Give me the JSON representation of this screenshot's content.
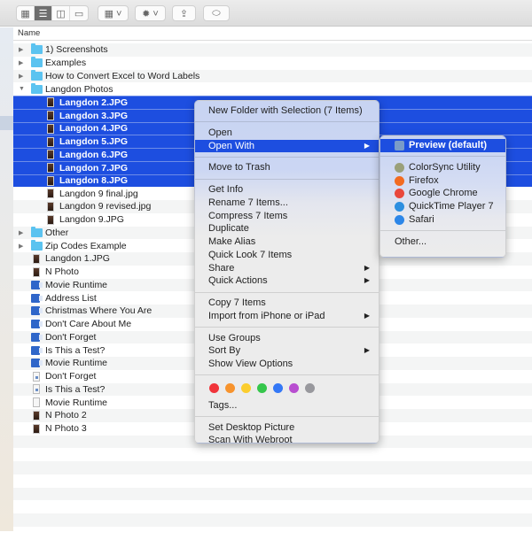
{
  "toolbar": {
    "view_buttons": [
      "icon-view",
      "list-view",
      "column-view",
      "gallery-view"
    ],
    "active_view": "list-view",
    "group_button": "group-icon",
    "action_button": "gear-icon",
    "share_button": "share-icon",
    "tag_button": "tag-icon"
  },
  "header": {
    "name_column": "Name"
  },
  "files": [
    {
      "name": "1) Screenshots",
      "type": "folder",
      "level": 0,
      "disclosure": "collapsed"
    },
    {
      "name": "Examples",
      "type": "folder",
      "level": 0,
      "disclosure": "collapsed"
    },
    {
      "name": "How to Convert Excel to Word Labels",
      "type": "folder",
      "level": 0,
      "disclosure": "collapsed"
    },
    {
      "name": "Langdon Photos",
      "type": "folder",
      "level": 0,
      "disclosure": "expanded"
    },
    {
      "name": "Langdon 2.JPG",
      "type": "image",
      "level": 1,
      "selected": true
    },
    {
      "name": "Langdon 3.JPG",
      "type": "image",
      "level": 1,
      "selected": true
    },
    {
      "name": "Langdon 4.JPG",
      "type": "image",
      "level": 1,
      "selected": true
    },
    {
      "name": "Langdon 5.JPG",
      "type": "image",
      "level": 1,
      "selected": true
    },
    {
      "name": "Langdon 6.JPG",
      "type": "image",
      "level": 1,
      "selected": true
    },
    {
      "name": "Langdon 7.JPG",
      "type": "image",
      "level": 1,
      "selected": true
    },
    {
      "name": "Langdon 8.JPG",
      "type": "image",
      "level": 1,
      "selected": true
    },
    {
      "name": "Langdon 9 final.jpg",
      "type": "image",
      "level": 1
    },
    {
      "name": "Langdon 9 revised.jpg",
      "type": "image",
      "level": 1
    },
    {
      "name": "Langdon 9.JPG",
      "type": "image",
      "level": 1
    },
    {
      "name": "Other",
      "type": "folder",
      "level": 0,
      "disclosure": "collapsed"
    },
    {
      "name": "Zip Codes Example",
      "type": "folder",
      "level": 0,
      "disclosure": "collapsed"
    },
    {
      "name": "Langdon 1.JPG",
      "type": "image",
      "level": 0
    },
    {
      "name": "N Photo",
      "type": "image",
      "level": 0
    },
    {
      "name": "Movie Runtime",
      "type": "word",
      "level": 0
    },
    {
      "name": "Address List",
      "type": "word",
      "level": 0
    },
    {
      "name": "Christmas Where You Are",
      "type": "word",
      "level": 0
    },
    {
      "name": "Don't Care About Me",
      "type": "word",
      "level": 0
    },
    {
      "name": "Don't Forget",
      "type": "word",
      "level": 0
    },
    {
      "name": "Is This a Test?",
      "type": "word",
      "level": 0
    },
    {
      "name": "Movie Runtime",
      "type": "word",
      "level": 0
    },
    {
      "name": "Don't Forget",
      "type": "txt",
      "level": 0
    },
    {
      "name": "Is This a Test?",
      "type": "txt",
      "level": 0
    },
    {
      "name": "Movie Runtime",
      "type": "blank",
      "level": 0
    },
    {
      "name": "N Photo 2",
      "type": "image",
      "level": 0
    },
    {
      "name": "N Photo 3",
      "type": "image",
      "level": 0
    }
  ],
  "context_menu": {
    "groups": [
      [
        {
          "label": "New Folder with Selection (7 Items)"
        }
      ],
      [
        {
          "label": "Open"
        },
        {
          "label": "Open With",
          "submenu": true,
          "highlighted": true
        }
      ],
      [
        {
          "label": "Move to Trash"
        }
      ],
      [
        {
          "label": "Get Info"
        },
        {
          "label": "Rename 7 Items..."
        },
        {
          "label": "Compress 7 Items"
        },
        {
          "label": "Duplicate"
        },
        {
          "label": "Make Alias"
        },
        {
          "label": "Quick Look 7 Items"
        },
        {
          "label": "Share",
          "submenu": true
        },
        {
          "label": "Quick Actions",
          "submenu": true
        }
      ],
      [
        {
          "label": "Copy 7 Items"
        },
        {
          "label": "Import from iPhone or iPad",
          "submenu": true
        }
      ],
      [
        {
          "label": "Use Groups"
        },
        {
          "label": "Sort By",
          "submenu": true
        },
        {
          "label": "Show View Options"
        }
      ],
      "tags",
      [
        {
          "label": "Set Desktop Picture"
        },
        {
          "label": "Scan With Webroot"
        }
      ]
    ],
    "tag_colors": [
      {
        "name": "red",
        "color": "#f0343a"
      },
      {
        "name": "orange",
        "color": "#f7932d"
      },
      {
        "name": "yellow",
        "color": "#fbcd2e"
      },
      {
        "name": "green",
        "color": "#35c64b"
      },
      {
        "name": "blue",
        "color": "#3478f6"
      },
      {
        "name": "purple",
        "color": "#b84ed0"
      },
      {
        "name": "gray",
        "color": "#98989d"
      }
    ],
    "tags_label": "Tags..."
  },
  "open_with_submenu": {
    "apps": [
      {
        "label": "Preview (default)",
        "icon": "preview-icon",
        "color": "#7a9cc8",
        "highlighted": true
      },
      "sep",
      {
        "label": "ColorSync Utility",
        "icon": "colorsync-icon",
        "color": "#9aa07a"
      },
      {
        "label": "Firefox",
        "icon": "firefox-icon",
        "color": "#f26b21"
      },
      {
        "label": "Google Chrome",
        "icon": "chrome-icon",
        "color": "#e9483c"
      },
      {
        "label": "QuickTime Player 7",
        "icon": "quicktime-icon",
        "color": "#2d8fe0"
      },
      {
        "label": "Safari",
        "icon": "safari-icon",
        "color": "#2c86e8"
      },
      "sep",
      {
        "label": "Other...",
        "plain": true
      }
    ]
  },
  "colors": {
    "selection": "#1d4ee0",
    "folder": "#5bc3f0"
  }
}
